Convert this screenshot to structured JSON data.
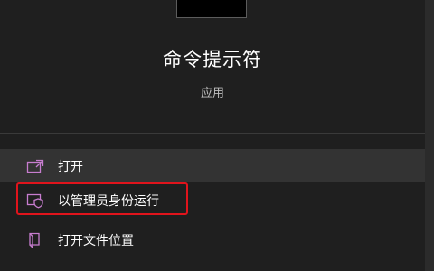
{
  "app": {
    "name": "命令提示符",
    "type": "应用"
  },
  "menu": [
    {
      "label": "打开",
      "icon": "open-external-icon"
    },
    {
      "label": "以管理员身份运行",
      "icon": "admin-shield-icon"
    },
    {
      "label": "打开文件位置",
      "icon": "file-location-icon"
    }
  ],
  "colors": {
    "background": "#1f1f1f",
    "hover": "#333333",
    "icon_accent": "#c77dcf",
    "highlight": "#e0141c"
  }
}
